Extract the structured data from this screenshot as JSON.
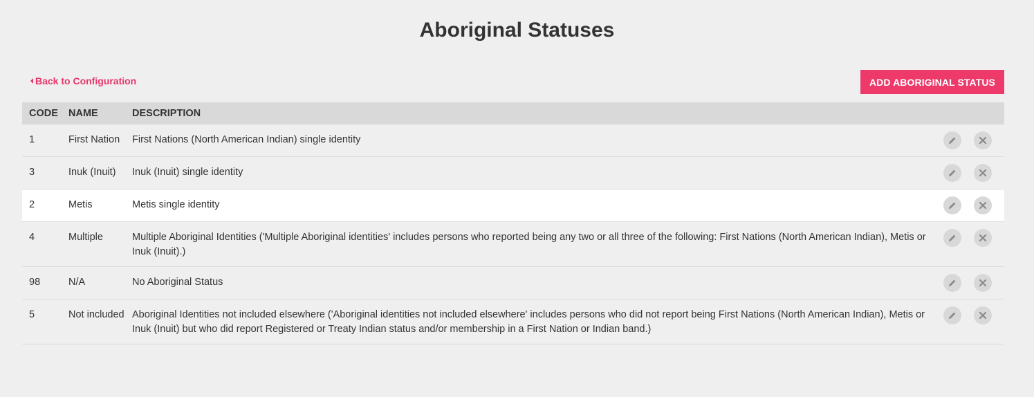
{
  "page": {
    "title": "Aboriginal Statuses"
  },
  "toolbar": {
    "back_label": "Back to Configuration",
    "add_label": "ADD ABORIGINAL STATUS"
  },
  "table": {
    "columns": [
      "CODE",
      "NAME",
      "DESCRIPTION"
    ],
    "rows": [
      {
        "code": "1",
        "name": "First Nation",
        "description": "First Nations (North American Indian) single identity"
      },
      {
        "code": "3",
        "name": "Inuk (Inuit)",
        "description": "Inuk (Inuit) single identity"
      },
      {
        "code": "2",
        "name": "Metis",
        "description": "Metis single identity"
      },
      {
        "code": "4",
        "name": "Multiple",
        "description": "Multiple Aboriginal Identities ('Multiple Aboriginal identities' includes persons who reported being any two or all three of the following: First Nations (North American Indian), Metis or Inuk (Inuit).)"
      },
      {
        "code": "98",
        "name": "N/A",
        "description": "No Aboriginal Status"
      },
      {
        "code": "5",
        "name": "Not included",
        "description": "Aboriginal Identities not included elsewhere ('Aboriginal identities not included elsewhere' includes persons who did not report being First Nations (North American Indian), Metis or Inuk (Inuit) but who did report Registered or Treaty Indian status and/or membership in a First Nation or Indian band.)"
      }
    ],
    "row_actions": [
      "pencil-icon",
      "x-icon"
    ],
    "highlighted_row": 2
  },
  "colors": {
    "accent": "#ee3a6b",
    "header_bg": "#d9d9d9",
    "page_bg": "#efefef"
  }
}
